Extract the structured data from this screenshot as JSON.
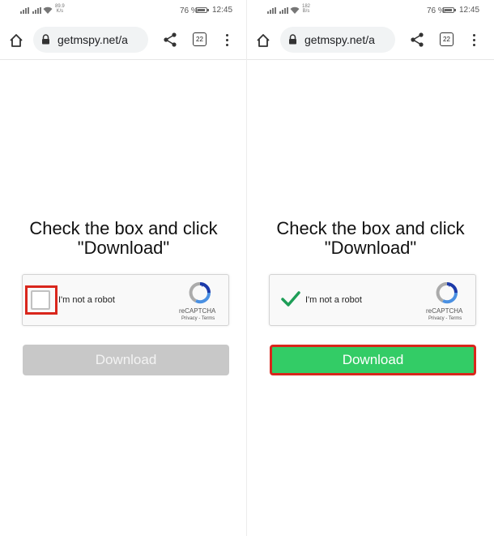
{
  "panels": [
    {
      "status": {
        "net_speed_value": "89.9",
        "net_speed_unit": "K/s",
        "battery": "76 %",
        "time": "12:45"
      },
      "browser": {
        "url": "getmspy.net/a",
        "tab_count": "22"
      },
      "content": {
        "heading_line1": "Check the box and click",
        "heading_line2": "\"Download\"",
        "captcha": {
          "label": "I'm not a robot",
          "brand": "reCAPTCHA",
          "links": "Privacy - Terms",
          "checked": false,
          "highlighted": true
        },
        "download_label": "Download",
        "download_enabled": false
      }
    },
    {
      "status": {
        "net_speed_value": "182",
        "net_speed_unit": "B/s",
        "battery": "76 %",
        "time": "12:45"
      },
      "browser": {
        "url": "getmspy.net/a",
        "tab_count": "22"
      },
      "content": {
        "heading_line1": "Check the box and click",
        "heading_line2": "\"Download\"",
        "captcha": {
          "label": "I'm not a robot",
          "brand": "reCAPTCHA",
          "links": "Privacy - Terms",
          "checked": true,
          "highlighted": false
        },
        "download_label": "Download",
        "download_enabled": true
      }
    }
  ],
  "icons": {
    "home": "home-icon",
    "lock": "lock-icon",
    "share": "share-icon",
    "tabs": "tabs-icon",
    "menu": "more-vert-icon",
    "recaptcha": "recaptcha-logo-icon",
    "check": "checkmark-icon"
  },
  "colors": {
    "download_enabled": "#33cc66",
    "download_disabled": "#c8c8c8",
    "highlight": "#d9261c",
    "checkmark": "#1e9e57",
    "url_bar_bg": "#f1f3f4"
  }
}
